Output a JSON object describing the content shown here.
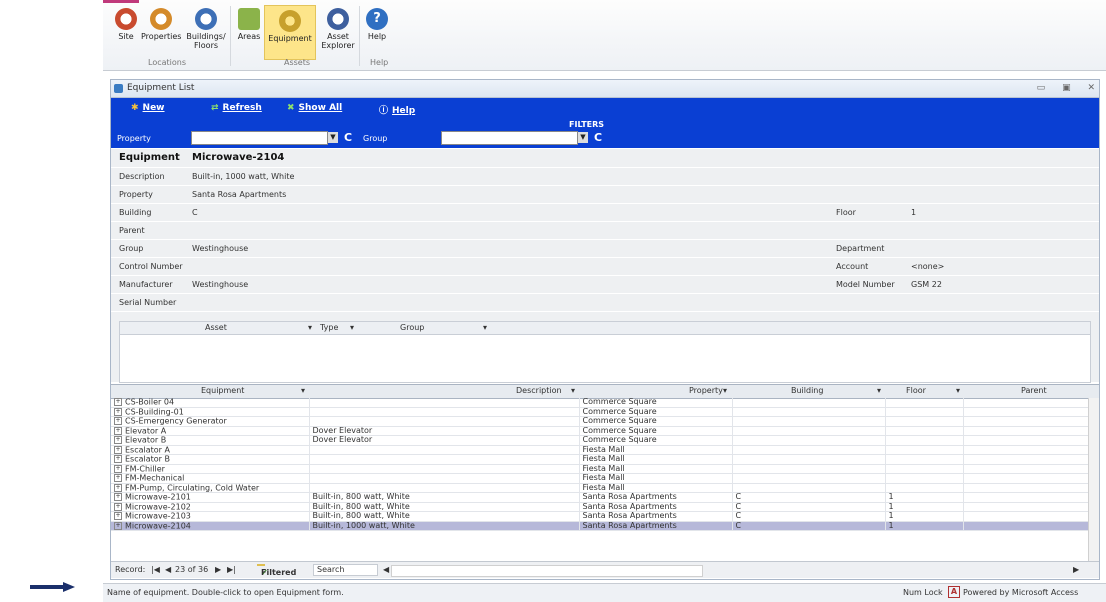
{
  "ribbon": {
    "buttons": [
      {
        "label": "Site",
        "icon": "site-icon"
      },
      {
        "label": "Properties",
        "icon": "properties-icon"
      },
      {
        "label": "Buildings/ Floors",
        "icon": "buildings-icon"
      },
      {
        "label": "Areas",
        "icon": "home-icon"
      },
      {
        "label": "Equipment",
        "icon": "equipment-gear-icon"
      },
      {
        "label": "Asset Explorer",
        "icon": "asset-explorer-icon"
      },
      {
        "label": "Help",
        "icon": "help-icon"
      }
    ],
    "groups": [
      "Locations",
      "Assets",
      "Help"
    ]
  },
  "window": {
    "title": "Equipment List",
    "toolbar": {
      "new": "New",
      "refresh": "Refresh",
      "show_all": "Show All",
      "help": "Help"
    },
    "filters_title": "FILTERS",
    "filter_property_label": "Property",
    "filter_group_label": "Group",
    "clear_label": "C"
  },
  "form": {
    "equipment_label": "Equipment",
    "equipment_value": "Microwave-2104",
    "description_label": "Description",
    "description_value": "Built-in, 1000 watt, White",
    "property_label": "Property",
    "property_value": "Santa Rosa Apartments",
    "building_label": "Building",
    "building_value": "C",
    "floor_label": "Floor",
    "floor_value": "1",
    "parent_label": "Parent",
    "group_label": "Group",
    "group_value": "Westinghouse",
    "department_label": "Department",
    "control_label": "Control Number",
    "account_label": "Account",
    "account_value": "<none>",
    "manufacturer_label": "Manufacturer",
    "manufacturer_value": "Westinghouse",
    "model_label": "Model Number",
    "model_value": "GSM 22",
    "serial_label": "Serial Number",
    "subgrid_headers": [
      "Asset",
      "Type",
      "Group"
    ]
  },
  "grid": {
    "headers": [
      "Equipment",
      "Description",
      "Property",
      "Building",
      "Floor",
      "Parent"
    ],
    "rows": [
      [
        "CS-Boiler 04",
        "",
        "Commerce Square",
        "",
        "",
        ""
      ],
      [
        "CS-Building-01",
        "",
        "Commerce Square",
        "",
        "",
        ""
      ],
      [
        "CS-Emergency Generator",
        "",
        "Commerce Square",
        "",
        "",
        ""
      ],
      [
        "Elevator A",
        "Dover Elevator",
        "Commerce Square",
        "",
        "",
        ""
      ],
      [
        "Elevator B",
        "Dover Elevator",
        "Commerce Square",
        "",
        "",
        ""
      ],
      [
        "Escalator A",
        "",
        "Fiesta Mall",
        "",
        "",
        ""
      ],
      [
        "Escalator B",
        "",
        "Fiesta Mall",
        "",
        "",
        ""
      ],
      [
        "FM-Chiller",
        "",
        "Fiesta Mall",
        "",
        "",
        ""
      ],
      [
        "FM-Mechanical",
        "",
        "Fiesta Mall",
        "",
        "",
        ""
      ],
      [
        "FM-Pump, Circulating, Cold Water",
        "",
        "Fiesta Mall",
        "",
        "",
        ""
      ],
      [
        "Microwave-2101",
        "Built-in, 800 watt, White",
        "Santa Rosa Apartments",
        "C",
        "1",
        ""
      ],
      [
        "Microwave-2102",
        "Built-in, 800 watt, White",
        "Santa Rosa Apartments",
        "C",
        "1",
        ""
      ],
      [
        "Microwave-2103",
        "Built-in, 800 watt, White",
        "Santa Rosa Apartments",
        "C",
        "1",
        ""
      ],
      [
        "Microwave-2104",
        "Built-in, 1000 watt, White",
        "Santa Rosa Apartments",
        "C",
        "1",
        ""
      ]
    ],
    "selected_index": 13
  },
  "nav": {
    "record_label": "Record:",
    "position": "23 of 36",
    "filtered": "Filtered",
    "search": "Search"
  },
  "status": {
    "message": "Name of equipment. Double-click to open Equipment form.",
    "numlock": "Num Lock",
    "powered": "Powered by Microsoft Access"
  }
}
